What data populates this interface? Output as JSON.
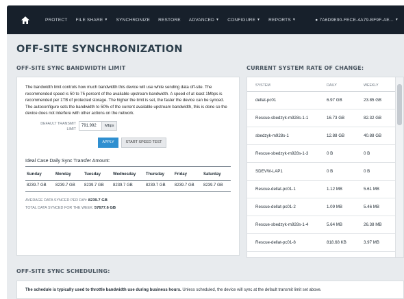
{
  "nav": {
    "items": [
      "PROTECT",
      "FILE SHARE",
      "SYNCHRONIZE",
      "RESTORE",
      "ADVANCED",
      "CONFIGURE",
      "REPORTS"
    ],
    "dropdowns": [
      false,
      true,
      false,
      false,
      true,
      true,
      true
    ],
    "user": "7A6D9E90-FECE-4A79-BF9F-AE..."
  },
  "page": {
    "title": "OFF-SITE SYNCHRONIZATION"
  },
  "bandwidth": {
    "title": "OFF-SITE SYNC BANDWIDTH LIMIT",
    "description": "The bandwidth limit controls how much bandwidth this device will use while sending data off-site. The recommended speed is 50 to 75 percent of the available upstream bandwidth. A speed of at least 1Mbps is recommended per 1TB of protected storage. The higher the limit is set, the faster the device can be synced. The autoconfigure sets the bandwidth to 50% of the current available upstream bandwidth, this is done so the device does not interfere with other actions on the network.",
    "limit_label": "DEFAULT TRANSMIT LIMIT",
    "limit_value": "791.992",
    "limit_unit": "Mbps",
    "apply_label": "APPLY",
    "speed_test_label": "START SPEED TEST",
    "ideal_title": "Ideal Case Daily Sync Transfer Amount:",
    "days": [
      "Sunday",
      "Monday",
      "Tuesday",
      "Wednesday",
      "Thursday",
      "Friday",
      "Saturday"
    ],
    "day_values": [
      "8239.7 GB",
      "8239.7 GB",
      "8239.7 GB",
      "8239.7 GB",
      "8239.7 GB",
      "8239.7 GB",
      "8239.7 GB"
    ],
    "avg_label": "AVERAGE DATA SYNCED PER DAY:",
    "avg_value": "8239.7 GB",
    "total_label": "TOTAL DATA SYNCED FOR THE WEEK:",
    "total_value": "57677.6 GB"
  },
  "rate": {
    "title": "CURRENT SYSTEM RATE OF CHANGE:",
    "columns": [
      "SYSTEM",
      "DAILY",
      "WEEKLY"
    ],
    "rows": [
      {
        "system": "dellat-pc01",
        "daily": "6.97 GB",
        "weekly": "23.85 GB"
      },
      {
        "system": "Rescue-sbedzyk-m928s-1-1",
        "daily": "16.73 GB",
        "weekly": "82.32 GB"
      },
      {
        "system": "sbedzyk-m928s-1",
        "daily": "12.88 GB",
        "weekly": "40.88 GB"
      },
      {
        "system": "Rescue-sbedzyk-m928s-1-3",
        "daily": "0 B",
        "weekly": "0 B"
      },
      {
        "system": "SDEVW-LAP1",
        "daily": "0 B",
        "weekly": "0 B"
      },
      {
        "system": "Rescue-dellat-pc01-1",
        "daily": "1.12 MB",
        "weekly": "5.61 MB"
      },
      {
        "system": "Rescue-dellat-pc01-2",
        "daily": "1.09 MB",
        "weekly": "5.46 MB"
      },
      {
        "system": "Rescue-sbedzyk-m928s-1-4",
        "daily": "5.64 MB",
        "weekly": "26.38 MB"
      },
      {
        "system": "Rescue-dellat-pc01-8",
        "daily": "818.68 KB",
        "weekly": "3.97 MB"
      }
    ]
  },
  "scheduling": {
    "title": "OFF-SITE SYNC SCHEDULING:",
    "text_bold": "The schedule is typically used to throttle bandwidth use during business hours.",
    "text_rest": " Unless scheduled, the device will sync at the default transmit limit set above."
  },
  "colors": {
    "navbar": "#17202b",
    "accent": "#2f8fd0",
    "background": "#e8ebee"
  }
}
